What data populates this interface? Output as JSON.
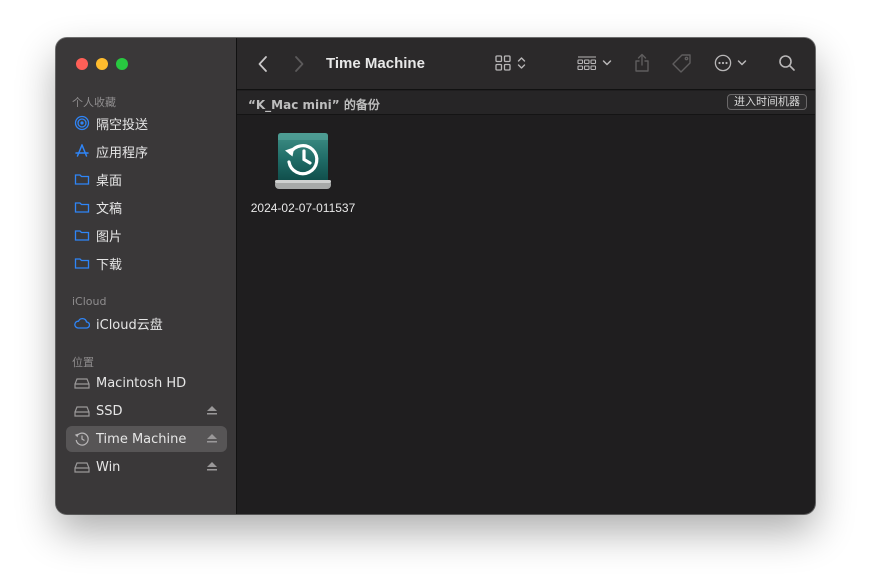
{
  "window": {
    "title": "Time Machine"
  },
  "sidebar": {
    "sections": [
      {
        "title": "个人收藏"
      },
      {
        "title": "iCloud"
      },
      {
        "title": "位置"
      }
    ],
    "favorites": [
      {
        "label": "隔空投送",
        "icon": "airdrop-icon"
      },
      {
        "label": "应用程序",
        "icon": "applications-icon"
      },
      {
        "label": "桌面",
        "icon": "folder-icon"
      },
      {
        "label": "文稿",
        "icon": "folder-icon"
      },
      {
        "label": "图片",
        "icon": "folder-icon"
      },
      {
        "label": "下载",
        "icon": "folder-icon"
      }
    ],
    "icloud": [
      {
        "label": "iCloud云盘",
        "icon": "cloud-icon"
      }
    ],
    "locations": [
      {
        "label": "Macintosh HD",
        "icon": "disk-icon",
        "eject": false
      },
      {
        "label": "SSD",
        "icon": "disk-icon",
        "eject": true
      },
      {
        "label": "Time Machine",
        "icon": "time-machine-icon",
        "eject": true,
        "selected": true
      },
      {
        "label": "Win",
        "icon": "disk-icon",
        "eject": true
      }
    ]
  },
  "pathbar": {
    "label": "“K_Mac mini” 的备份",
    "button": "进入时间机器"
  },
  "files": [
    {
      "name": "2024-02-07-011537",
      "icon": "time-machine-drive-icon"
    }
  ],
  "colors": {
    "accent": "#2f85f7",
    "sidebar_bg": "#3a3839",
    "content_bg": "#1f1e1f",
    "selection": "#575556"
  }
}
